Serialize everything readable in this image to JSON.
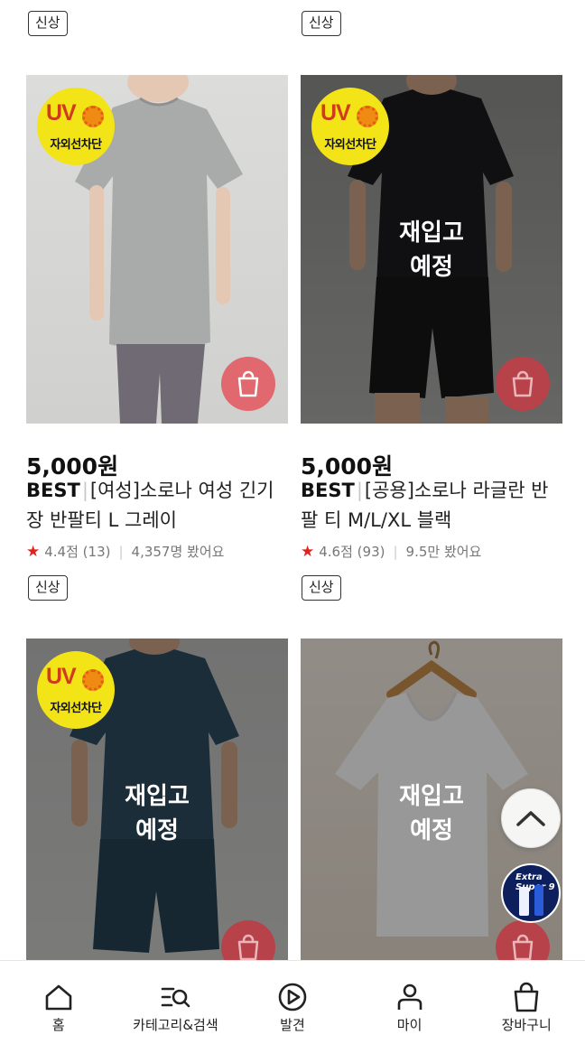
{
  "products": [
    {
      "price": "5,000원",
      "best": "BEST",
      "name": "[여성]소로나 여성 긴기장 반팔티 L 그레이",
      "rating": "4.4점 (13)",
      "views": "4,357명 봤어요",
      "badge": "신상",
      "uv": true,
      "uv_text": "UV",
      "uv_label": "자외선차단",
      "restock": false
    },
    {
      "price": "5,000원",
      "best": "BEST",
      "name": "[공용]소로나 라글란 반팔 티 M/L/XL 블랙",
      "rating": "4.6점 (93)",
      "views": "9.5만 봤어요",
      "badge": "신상",
      "uv": true,
      "uv_text": "UV",
      "uv_label": "자외선차단",
      "restock": true,
      "restock_line1": "재입고",
      "restock_line2": "예정"
    },
    {
      "uv": true,
      "uv_text": "UV",
      "uv_label": "자외선차단",
      "restock": true,
      "restock_line1": "재입고",
      "restock_line2": "예정"
    },
    {
      "restock": true,
      "restock_line1": "재입고",
      "restock_line2": "예정"
    }
  ],
  "top_badges": [
    "신상",
    "신상"
  ],
  "star_color": "#e1221e",
  "cart_button_color": "#e0686e",
  "floating_ad_text": "Extra Super 9",
  "tabbar": [
    {
      "label": "홈",
      "icon": "home-icon"
    },
    {
      "label": "카테고리&검색",
      "icon": "category-search-icon"
    },
    {
      "label": "발견",
      "icon": "discover-play-icon"
    },
    {
      "label": "마이",
      "icon": "person-icon"
    },
    {
      "label": "장바구니",
      "icon": "shopping-bag-icon"
    }
  ]
}
